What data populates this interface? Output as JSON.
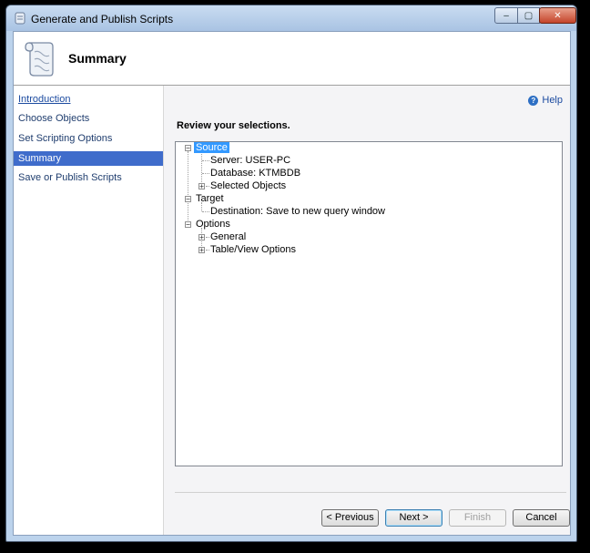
{
  "window": {
    "title": "Generate and Publish Scripts",
    "min_glyph": "–",
    "max_glyph": "▢",
    "close_glyph": "✕"
  },
  "header": {
    "title": "Summary",
    "icon": "scroll-icon"
  },
  "sidebar": {
    "items": [
      {
        "label": "Introduction",
        "state": "link"
      },
      {
        "label": "Choose Objects",
        "state": "normal"
      },
      {
        "label": "Set Scripting Options",
        "state": "normal"
      },
      {
        "label": "Summary",
        "state": "active"
      },
      {
        "label": "Save or Publish Scripts",
        "state": "normal"
      }
    ]
  },
  "help": {
    "label": "Help"
  },
  "main": {
    "heading": "Review your selections."
  },
  "tree": {
    "source": {
      "label": "Source",
      "server": "Server: USER-PC",
      "database": "Database: KTMBDB",
      "selected": "Selected Objects"
    },
    "target": {
      "label": "Target",
      "destination": "Destination: Save to new query window"
    },
    "options": {
      "label": "Options",
      "general": "General",
      "tableview": "Table/View Options"
    }
  },
  "buttons": {
    "previous": "< Previous",
    "next": "Next >",
    "finish": "Finish",
    "cancel": "Cancel"
  },
  "colors": {
    "active_nav": "#3f6ccb",
    "selection": "#3399ff",
    "link": "#1c4ba0"
  }
}
